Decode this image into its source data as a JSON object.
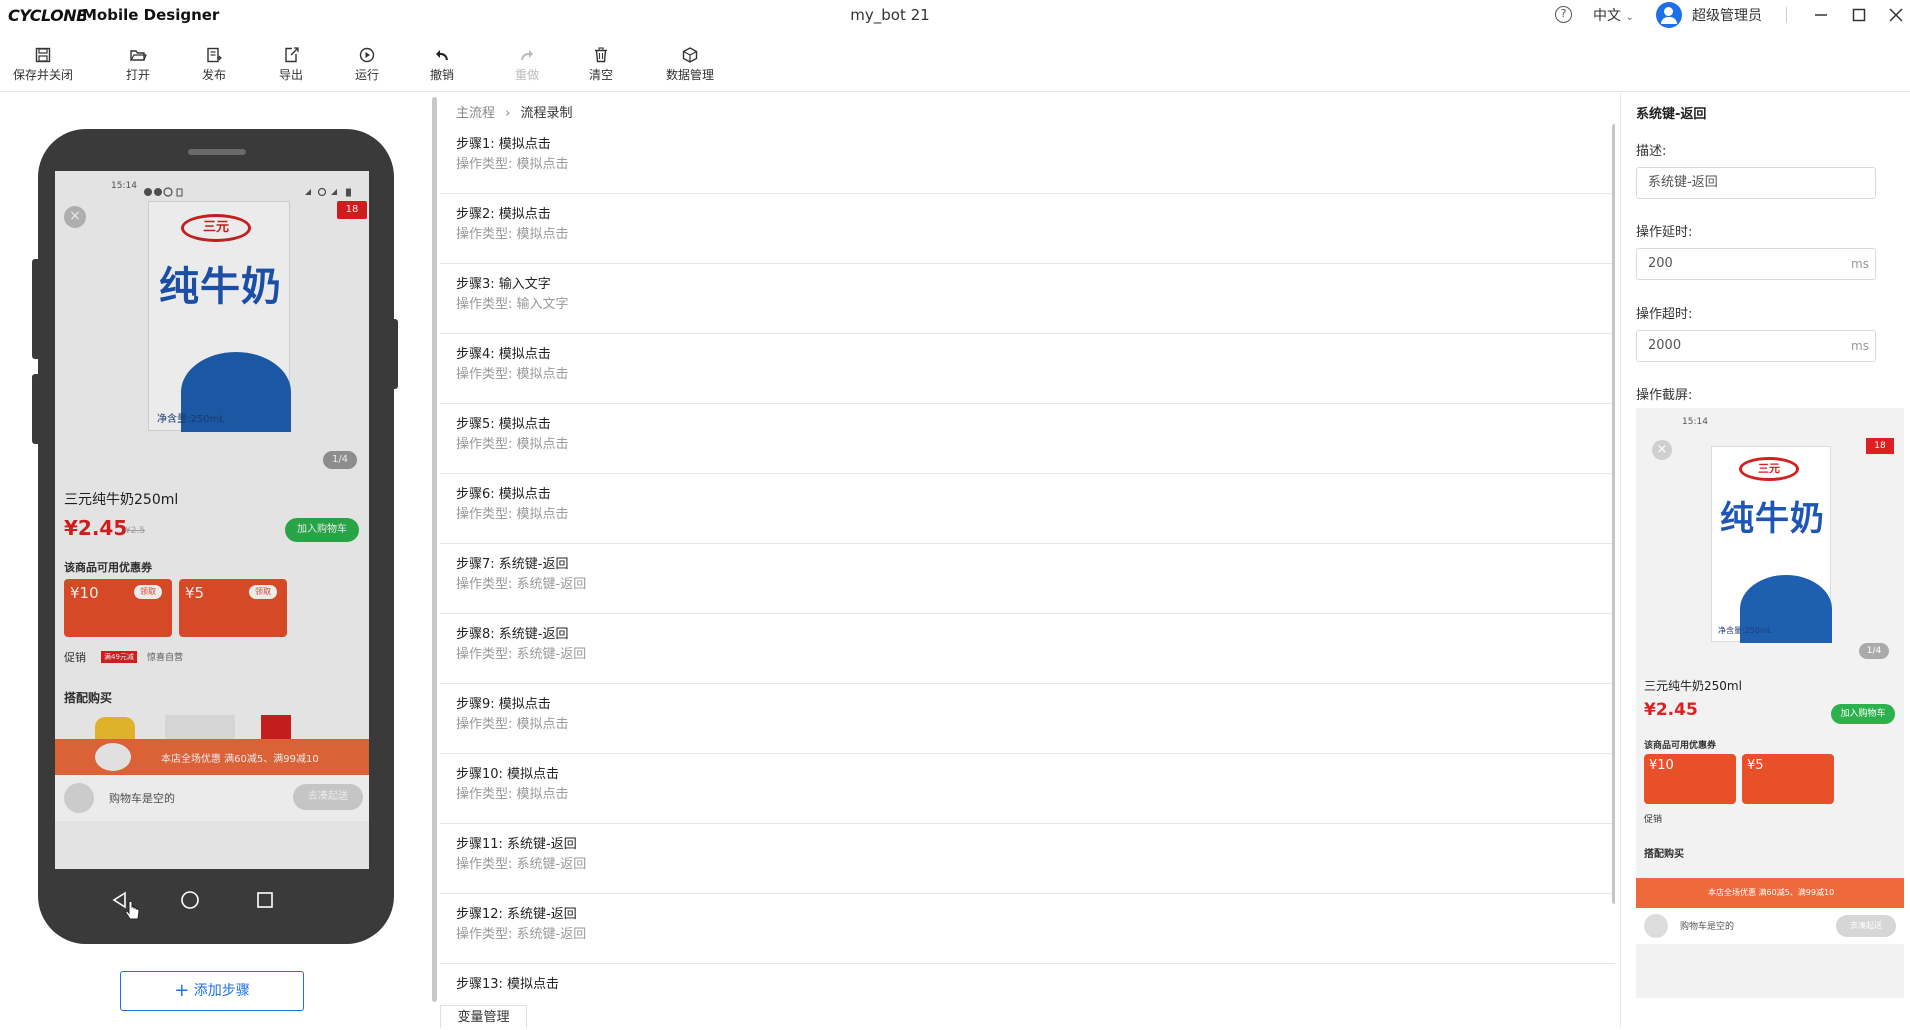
{
  "app": {
    "logo_text": "CYCLONE",
    "app_name": "Mobile Designer",
    "window_title": "my_bot 21",
    "language": "中文",
    "user_name": "超级管理员"
  },
  "toolbar": {
    "save_close": "保存并关闭",
    "open": "打开",
    "publish": "发布",
    "export": "导出",
    "run": "运行",
    "undo": "撤销",
    "redo": "重做",
    "clear": "清空",
    "data_mgmt": "数据管理"
  },
  "phone": {
    "status_time": "15:14",
    "product_title": "三元纯牛奶250ml",
    "price": "¥2.45",
    "price_small": "¥2.5",
    "add_cart": "加入购物车",
    "image_counter": "1/4",
    "coupon_header": "该商品可用优惠券",
    "coupon1_value": "¥10",
    "coupon1_tag": "领取",
    "coupon2_value": "¥5",
    "coupon2_tag": "领取",
    "promo_label": "促销",
    "promo_tag": "满49元减",
    "promo_text": "惊喜自营",
    "bundle_label": "搭配购买",
    "banner_text": "本店全场优惠 满60减5、满99减10",
    "cart_text": "购物车是空的",
    "cart_button": "去凑起送",
    "box_brand": "三元",
    "box_text": "纯牛奶",
    "box_net": "净含量:250mL",
    "box_corner": "18"
  },
  "add_step_label": "添加步骤",
  "breadcrumb": {
    "root": "主流程",
    "current": "流程录制"
  },
  "steps": [
    {
      "title": "步骤1: 模拟点击",
      "type": "操作类型: 模拟点击"
    },
    {
      "title": "步骤2: 模拟点击",
      "type": "操作类型: 模拟点击"
    },
    {
      "title": "步骤3: 输入文字",
      "type": "操作类型: 输入文字"
    },
    {
      "title": "步骤4: 模拟点击",
      "type": "操作类型: 模拟点击"
    },
    {
      "title": "步骤5: 模拟点击",
      "type": "操作类型: 模拟点击"
    },
    {
      "title": "步骤6: 模拟点击",
      "type": "操作类型: 模拟点击"
    },
    {
      "title": "步骤7: 系统键-返回",
      "type": "操作类型: 系统键-返回"
    },
    {
      "title": "步骤8: 系统键-返回",
      "type": "操作类型: 系统键-返回"
    },
    {
      "title": "步骤9: 模拟点击",
      "type": "操作类型: 模拟点击"
    },
    {
      "title": "步骤10: 模拟点击",
      "type": "操作类型: 模拟点击"
    },
    {
      "title": "步骤11: 系统键-返回",
      "type": "操作类型: 系统键-返回"
    },
    {
      "title": "步骤12: 系统键-返回",
      "type": "操作类型: 系统键-返回"
    },
    {
      "title": "步骤13: 模拟点击",
      "type": ""
    }
  ],
  "var_tab": "变量管理",
  "props": {
    "title": "系统键-返回",
    "desc_label": "描述:",
    "desc_value": "系统键-返回",
    "delay_label": "操作延时:",
    "delay_value": "200",
    "delay_unit": "ms",
    "timeout_label": "操作超时:",
    "timeout_value": "2000",
    "timeout_unit": "ms",
    "screenshot_label": "操作截屏:"
  },
  "colors": {
    "accent": "#1e6fe8",
    "price_red": "#e02020",
    "cart_green": "#2bb24c",
    "coupon_orange": "#e8502a",
    "milk_blue": "#1e5fb0"
  }
}
